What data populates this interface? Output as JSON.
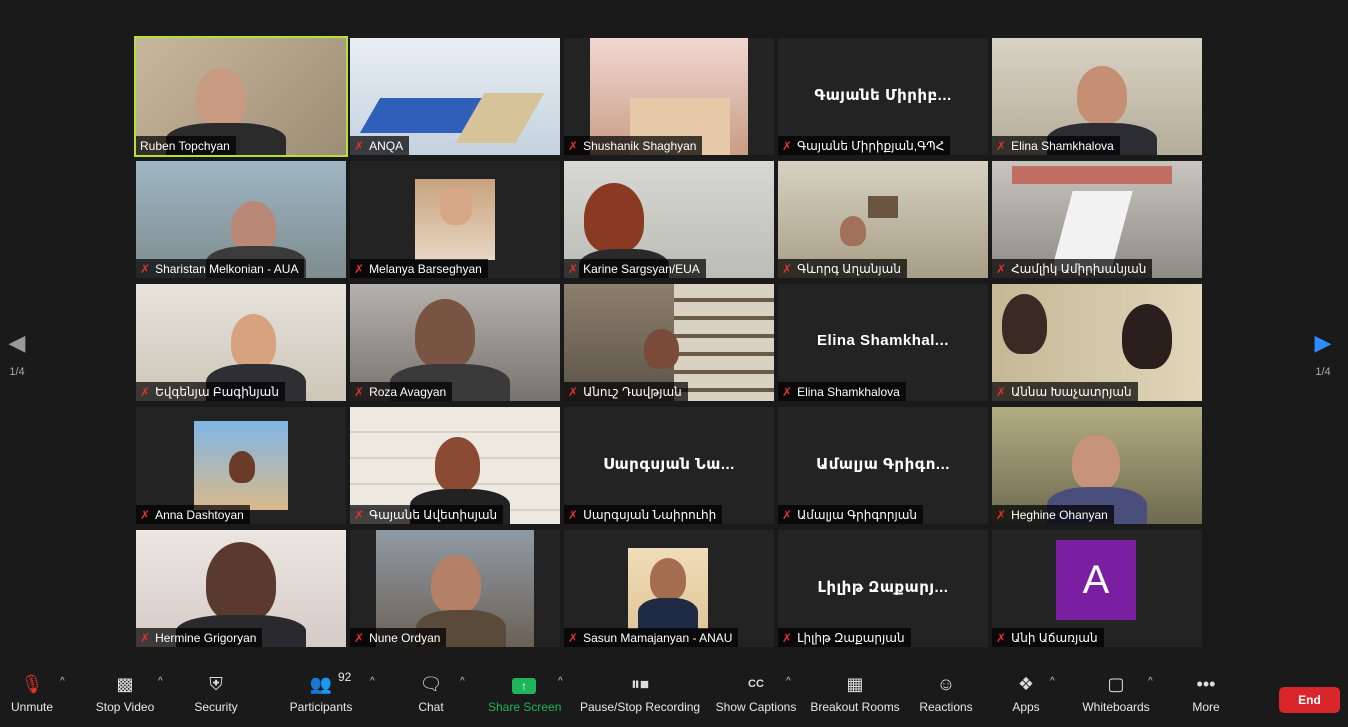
{
  "pager": {
    "left_label": "1/4",
    "right_label": "1/4"
  },
  "participants": [
    {
      "name": "Ruben Topchyan",
      "muted": false,
      "active": true
    },
    {
      "name": "ANQA",
      "muted": true
    },
    {
      "name": "Shushanik Shaghyan",
      "muted": true
    },
    {
      "name": "Գայանե Միրիքյան,ԳՊՀ",
      "muted": true,
      "big_label": "Գայանե Միրիբ..."
    },
    {
      "name": "Elina Shamkhalova",
      "muted": true
    },
    {
      "name": "Sharistan Melkonian - AUA",
      "muted": true
    },
    {
      "name": "Melanya Barseghyan",
      "muted": true
    },
    {
      "name": "Karine Sargsyan/EUA",
      "muted": true
    },
    {
      "name": "Գևորգ Աղանյան",
      "muted": true
    },
    {
      "name": "Համլիկ Ամիրխանյան",
      "muted": true
    },
    {
      "name": "Եվգենյա Բագինյան",
      "muted": true
    },
    {
      "name": "Roza Avagyan",
      "muted": true
    },
    {
      "name": "Անուշ Դավթյան",
      "muted": true
    },
    {
      "name": "Elina Shamkhalova",
      "muted": true,
      "big_label": "Elina Shamkhal..."
    },
    {
      "name": "Աննա Խաչատրյան",
      "muted": true
    },
    {
      "name": "Anna Dashtoyan",
      "muted": true
    },
    {
      "name": "Գայանե Ավետիսյան",
      "muted": true
    },
    {
      "name": "Սարգսյան Նաիրուհի",
      "muted": true,
      "big_label": "Սարգսյան Նա..."
    },
    {
      "name": "Ամալյա Գրիգորյան",
      "muted": true,
      "big_label": "Ամալյա Գրիգո..."
    },
    {
      "name": "Heghine Ohanyan",
      "muted": true
    },
    {
      "name": "Hermine Grigoryan",
      "muted": true
    },
    {
      "name": "Nune Ordyan",
      "muted": true
    },
    {
      "name": "Sasun Mamajanyan - ANAU",
      "muted": true
    },
    {
      "name": "Լիլիթ Զաքարյան",
      "muted": true,
      "big_label": "Լիլիթ Զաքարյ..."
    },
    {
      "name": "Անի Աճառյան",
      "muted": true,
      "avatar_letter": "A"
    }
  ],
  "toolbar": {
    "unmute": "Unmute",
    "stop_video": "Stop Video",
    "security": "Security",
    "participants": "Participants",
    "participants_count": "92",
    "chat": "Chat",
    "share_screen": "Share Screen",
    "pause_stop_recording": "Pause/Stop Recording",
    "show_captions": "Show Captions",
    "breakout_rooms": "Breakout Rooms",
    "reactions": "Reactions",
    "apps": "Apps",
    "whiteboards": "Whiteboards",
    "more": "More",
    "end": "End",
    "captions_icon_text": "CC"
  },
  "colors": {
    "active_speaker": "#b5df3a",
    "muted_icon": "#e0302f",
    "share_green": "#1fb45a",
    "end_red": "#d9262b",
    "avatar_purple": "#7b1fa2"
  }
}
